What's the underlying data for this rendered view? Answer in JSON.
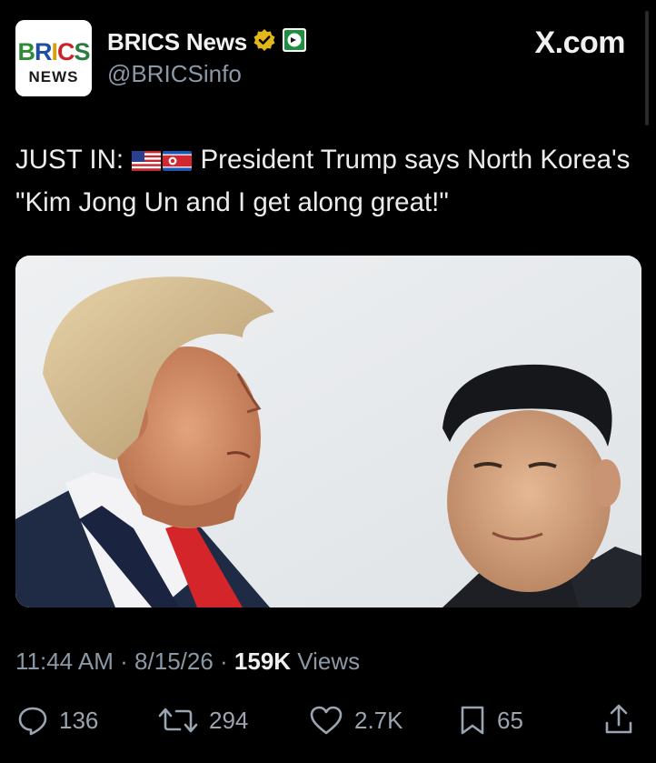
{
  "author": {
    "avatar_text_top": "BRICS",
    "avatar_text_bottom": "NEWS",
    "display_name": "BRICS News",
    "handle": "@BRICSinfo"
  },
  "brand": "X.com",
  "tweet": {
    "prefix": "JUST IN:",
    "body": " President Trump says North Korea's \"Kim Jong Un and I get along great!\""
  },
  "meta": {
    "time": "11:44 AM",
    "sep1": " · ",
    "date": "8/15/26",
    "sep2": " · ",
    "views": "159K",
    "views_label": " Views"
  },
  "actions": {
    "replies": "136",
    "reposts": "294",
    "likes": "2.7K",
    "bookmarks": "65"
  },
  "colors": {
    "background": "#000000",
    "verified_gold": "#e2b719",
    "muted": "#8b98a5"
  }
}
